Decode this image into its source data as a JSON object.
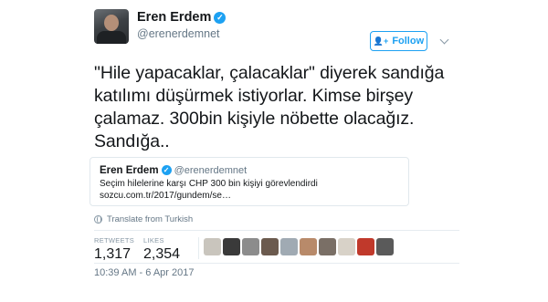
{
  "author": {
    "name": "Eren Erdem",
    "handle": "@erenerdemnet",
    "verified_glyph": "✓"
  },
  "follow": {
    "icon": "follow-user-icon",
    "icon_glyph": "👤+",
    "label": "Follow"
  },
  "tweet": {
    "text": "\"Hile yapacaklar, çalacaklar\" diyerek sandığa katılımı düşürmek istiyorlar. Kimse birşey çalamaz. 300bin kişiyle nöbette olacağız. Sandığa.."
  },
  "quoted_tweet": {
    "name": "Eren Erdem",
    "handle": "@erenerdemnet",
    "text": "Seçim hilelerine karşı CHP 300 bin kişiyi görevlendirdi",
    "link": "sozcu.com.tr/2017/gundem/se…"
  },
  "translate": {
    "icon": "globe-icon",
    "label": "Translate from Turkish"
  },
  "stats": {
    "retweets_label": "RETWEETS",
    "retweets_value": "1,317",
    "likes_label": "LIKES",
    "likes_value": "2,354"
  },
  "likers": [
    {
      "color": "#c9c5bd"
    },
    {
      "color": "#3a3a3a"
    },
    {
      "color": "#8c8c8c"
    },
    {
      "color": "#6b5a4e"
    },
    {
      "color": "#a0aab3"
    },
    {
      "color": "#b88a6a"
    },
    {
      "color": "#7a6f66"
    },
    {
      "color": "#d8d2c8"
    },
    {
      "color": "#c0392b"
    },
    {
      "color": "#5a5a5a"
    }
  ],
  "timestamp": "10:39 AM - 6 Apr 2017",
  "colors": {
    "accent": "#1da1f2",
    "text": "#14171a",
    "secondary": "#657786",
    "border": "#e1e8ed"
  }
}
